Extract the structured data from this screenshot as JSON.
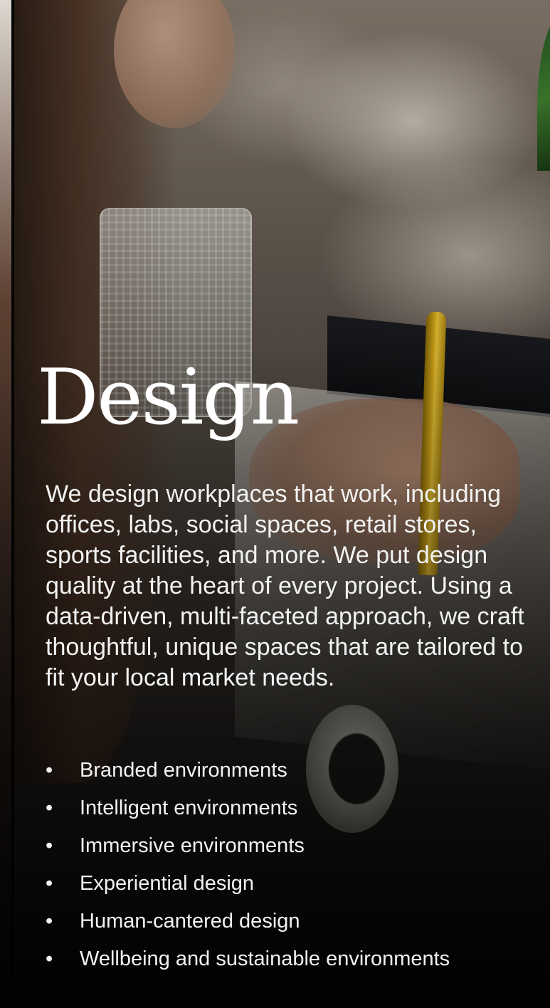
{
  "section": {
    "title": "Design",
    "description": "We design workplaces that work, including offices, labs, social spaces, retail stores, sports facilities, and more. We put design quality at the heart of every project. Using a data-driven, multi-faceted approach, we craft thoughtful, unique spaces that are tailored to fit your local market needs.",
    "features": [
      "Branded environments",
      "Intelligent environments",
      "Immersive environments",
      "Experiential design",
      "Human-cantered design",
      "Wellbeing and sustainable environments"
    ],
    "bullet_glyph": "•"
  },
  "colors": {
    "text": "#ffffff",
    "overlay": "#000000"
  }
}
